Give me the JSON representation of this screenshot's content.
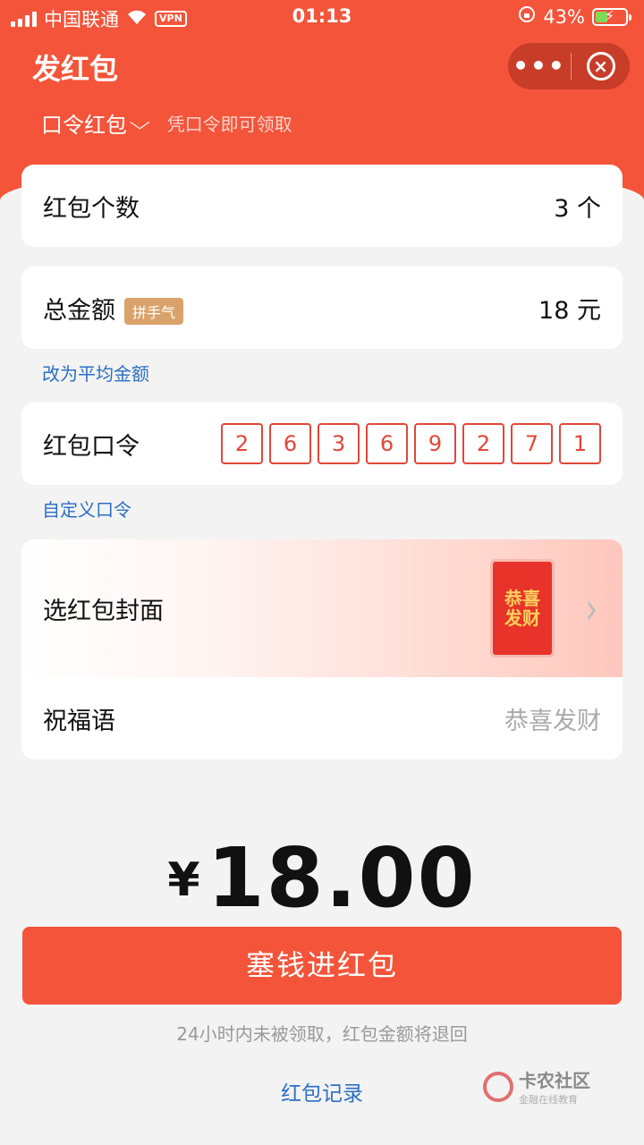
{
  "status_bar": {
    "carrier": "中国联通",
    "vpn": "VPN",
    "time": "01:13",
    "battery": "43%"
  },
  "header": {
    "title": "发红包",
    "more": "•••",
    "close": "×"
  },
  "packet_type": {
    "label": "口令红包",
    "hint": "凭口令即可领取"
  },
  "count": {
    "label": "红包个数",
    "value": "3 个"
  },
  "total": {
    "label": "总金额",
    "badge": "拼手气",
    "value": "18 元"
  },
  "switch_link": "改为平均金额",
  "password": {
    "label": "红包口令",
    "digits": [
      "2",
      "6",
      "3",
      "6",
      "9",
      "2",
      "7",
      "1"
    ]
  },
  "custom_link": "自定义口令",
  "cover": {
    "label": "选红包封面",
    "thumb_text": "恭喜发财",
    "arrow": "›"
  },
  "wish": {
    "label": "祝福语",
    "placeholder": "恭喜发财"
  },
  "amount": {
    "currency": "¥",
    "value": "18.00"
  },
  "submit_button": "塞钱进红包",
  "notice": "24小时内未被领取，红包金额将退回",
  "records_link": "红包记录",
  "watermark": {
    "name": "卡农社区",
    "slogan": "金融在线教育"
  },
  "colors": {
    "accent": "#f3543a",
    "link": "#2b6fc4",
    "code_border": "#e0473a",
    "badge": "#d9a26a"
  }
}
